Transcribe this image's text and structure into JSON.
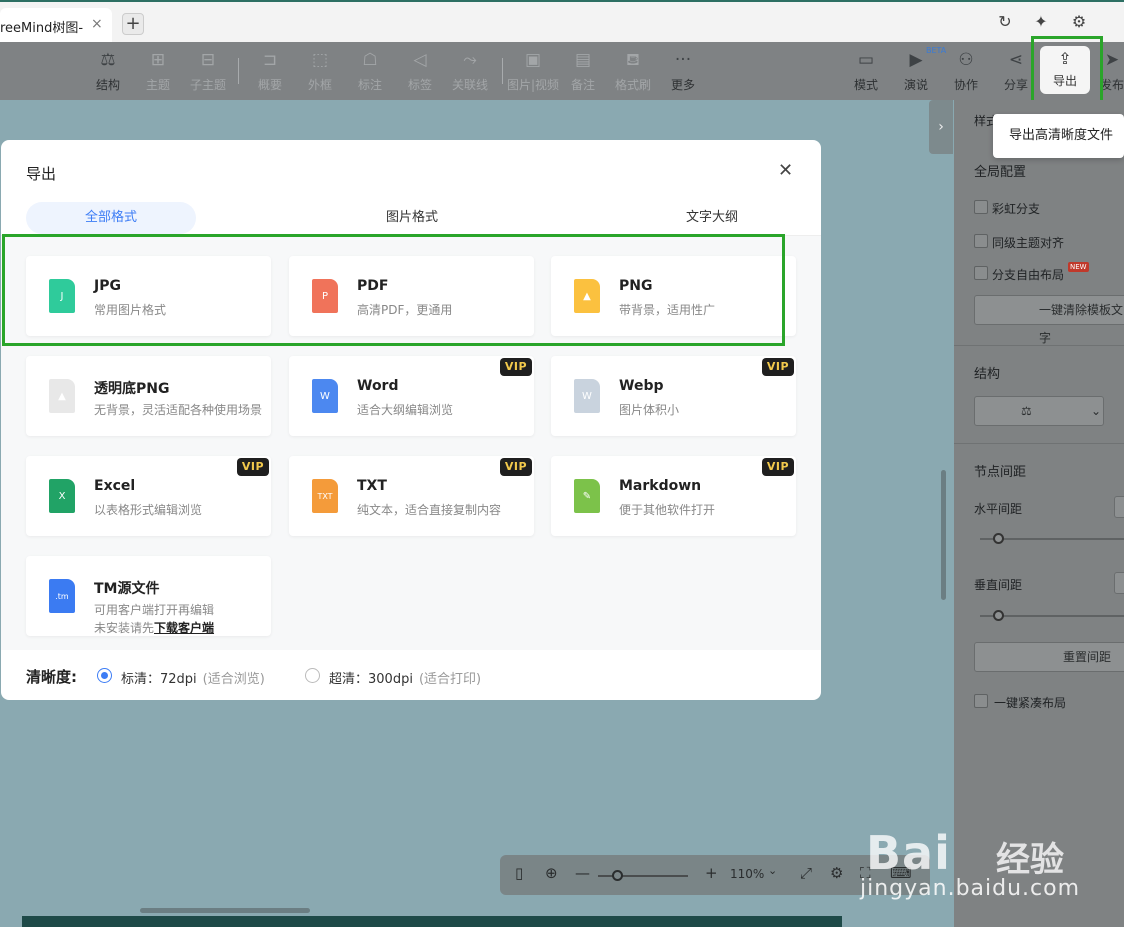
{
  "tab": {
    "title": "reeMind树图-",
    "close": "×",
    "new": "+"
  },
  "toolbar": {
    "items": [
      {
        "label": "结构",
        "icon": "⚖"
      },
      {
        "label": "主题",
        "icon": "⊞"
      },
      {
        "label": "子主题",
        "icon": "⊟"
      },
      {
        "label": "概要",
        "icon": "⊐"
      },
      {
        "label": "外框",
        "icon": "⬚"
      },
      {
        "label": "标注",
        "icon": "☖"
      },
      {
        "label": "标签",
        "icon": "◁"
      },
      {
        "label": "关联线",
        "icon": "⤳"
      },
      {
        "label": "图片|视频",
        "icon": "▣"
      },
      {
        "label": "备注",
        "icon": "▤"
      },
      {
        "label": "格式刷",
        "icon": "⛾"
      },
      {
        "label": "更多",
        "icon": "···"
      },
      {
        "label": "模式",
        "icon": "▭"
      },
      {
        "label": "演说",
        "icon": "▶"
      },
      {
        "label": "协作",
        "icon": "⚇"
      },
      {
        "label": "分享",
        "icon": "⋖"
      },
      {
        "label": "发布",
        "icon": "➤"
      }
    ],
    "export": {
      "label": "导出",
      "icon": "⇪"
    },
    "beta": "BETA"
  },
  "tooltip": "导出高清晰度文件",
  "right_panel": {
    "title": "样式",
    "global": "全局配置",
    "rainbow": "彩虹分支",
    "align": "同级主题对齐",
    "free": "分支自由布局",
    "new_badge": "NEW",
    "clear_btn": "一键清除模板文字",
    "structure": "结构",
    "structure_icon": "⚖",
    "chevron": "⌄",
    "spacing": "节点间距",
    "horizontal": "水平间距",
    "vertical": "垂直间距",
    "reset_btn": "重置间距",
    "compact": "一键紧凑布局"
  },
  "modal": {
    "title": "导出",
    "close": "✕",
    "tabs": [
      "全部格式",
      "图片格式",
      "文字大纲"
    ],
    "cards": [
      {
        "name": "JPG",
        "desc": "常用图片格式",
        "letter": "J",
        "color": "#2fcb9b",
        "vip": false
      },
      {
        "name": "PDF",
        "desc": "高清PDF，更通用",
        "letter": "P",
        "color": "#f0735a",
        "vip": false
      },
      {
        "name": "PNG",
        "desc": "带背景，适用性广",
        "letter": "▲",
        "color": "#fbc13f",
        "vip": false
      },
      {
        "name": "透明底PNG",
        "desc": "无背景，灵活适配各种使用场景",
        "letter": "▲",
        "color": "#e8e8e8",
        "vip": false
      },
      {
        "name": "Word",
        "desc": "适合大纲编辑浏览",
        "letter": "W",
        "color": "#4c88f0",
        "vip": true
      },
      {
        "name": "Webp",
        "desc": "图片体积小",
        "letter": "W",
        "color": "#c9d3de",
        "vip": true
      },
      {
        "name": "Excel",
        "desc": "以表格形式编辑浏览",
        "letter": "X",
        "color": "#21a366",
        "vip": true
      },
      {
        "name": "TXT",
        "desc": "纯文本，适合直接复制内容",
        "letter": "TXT",
        "color": "#f49b3a",
        "vip": true
      },
      {
        "name": "Markdown",
        "desc": "便于其他软件打开",
        "letter": "✎",
        "color": "#7cc24a",
        "vip": true
      },
      {
        "name": "TM源文件",
        "desc": "可用客户端打开再编辑",
        "desc2": "未安装请先",
        "link": "下载客户端",
        "letter": ".tm",
        "color": "#3b7bf2",
        "vip": false
      }
    ],
    "vip_label": "VIP",
    "footer": {
      "label": "清晰度:",
      "standard": "标清：72dpi",
      "standard_note": "(适合浏览)",
      "ultra": "超清：300dpi",
      "ultra_note": "(适合打印)"
    }
  },
  "zoom": {
    "level": "110%",
    "minus": "—",
    "plus": "+"
  },
  "watermark": {
    "brand": "Bai",
    "brand2": "经验",
    "url": "jingyan.baidu.com"
  }
}
